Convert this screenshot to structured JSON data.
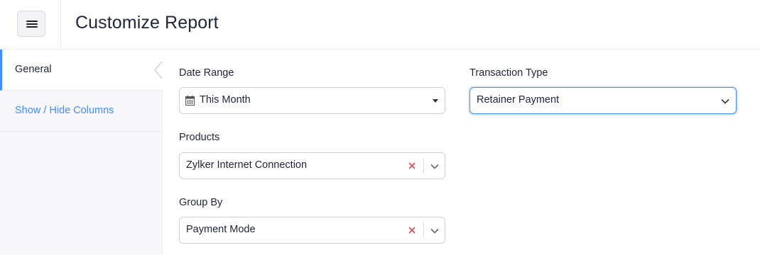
{
  "header": {
    "menu_icon": "hamburger-menu-icon",
    "title": "Customize Report"
  },
  "sidebar": {
    "items": [
      {
        "label": "General",
        "active": true
      },
      {
        "label": "Show / Hide Columns",
        "active": false
      }
    ],
    "collapse_icon": "chevron-left-icon"
  },
  "form": {
    "date_range": {
      "label": "Date Range",
      "value": "This Month",
      "icon": "calendar-icon"
    },
    "transaction_type": {
      "label": "Transaction Type",
      "value": "Retainer Payment"
    },
    "products": {
      "label": "Products",
      "value": "Zylker Internet Connection"
    },
    "group_by": {
      "label": "Group By",
      "value": "Payment Mode"
    }
  },
  "colors": {
    "accent": "#408dfb",
    "clear": "#e24a4a",
    "sidebar_bg": "#f7f7fa"
  }
}
